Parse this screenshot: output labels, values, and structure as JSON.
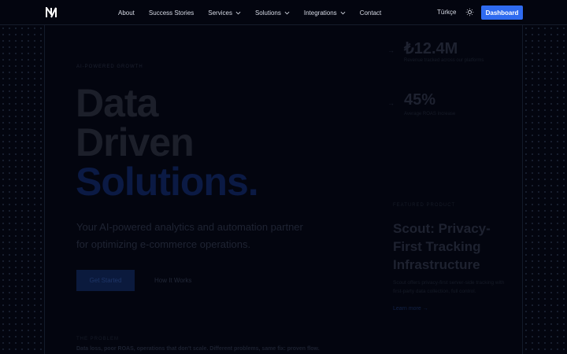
{
  "nav": {
    "links": [
      "About",
      "Success Stories",
      "Services",
      "Solutions",
      "Integrations",
      "Contact"
    ],
    "language": "Türkçe",
    "dashboard_label": "Dashboard"
  },
  "hero": {
    "eyebrow": "AI-POWERED GROWTH",
    "title_line1": "Data",
    "title_line2": "Driven",
    "title_line3": "Solutions.",
    "subtitle": "Your AI-powered analytics and automation partner for optimizing e-commerce operations.",
    "cta_primary": "Get Started",
    "cta_secondary": "How It Works",
    "bottom_eyebrow": "THE PROBLEM",
    "bottom_text": "Data loss, poor ROAS, operations that don't scale. Different problems, same fix: proven flow."
  },
  "stats": [
    {
      "value": "₺12.4M",
      "label": "Revenue tracked across our platforms"
    },
    {
      "value": "45%",
      "label": "Average ROAS increase"
    }
  ],
  "scout": {
    "tag": "FEATURED PRODUCT",
    "title": "Scout: Privacy-First Tracking Infrastructure",
    "description": "Scout offers privacy-first server-side tracking with first-party data collection, full control.",
    "link": "Learn more →"
  },
  "colors": {
    "accent": "#2f6bf0",
    "background": "#03050f"
  }
}
